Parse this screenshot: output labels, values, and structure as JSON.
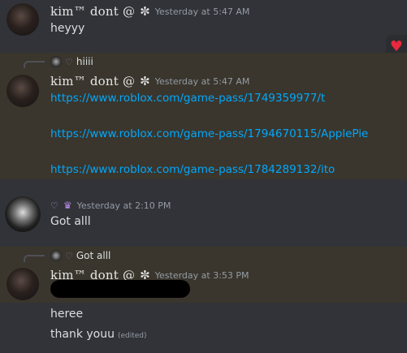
{
  "messages": {
    "m1": {
      "username": "kim™ dont @",
      "timestamp": "Yesterday at 5:47 AM",
      "text": "heyyy"
    },
    "m2": {
      "reply_text": "hiiii",
      "username": "kim™ dont @",
      "timestamp": "Yesterday at 5:47 AM",
      "links": [
        "https://www.roblox.com/game-pass/1749359977/t",
        "https://www.roblox.com/game-pass/1794670115/ApplePie",
        "https://www.roblox.com/game-pass/1784289132/ito"
      ]
    },
    "m3": {
      "timestamp": "Yesterday at 2:10 PM",
      "text": "Got alll"
    },
    "m4": {
      "reply_text": "Got alll",
      "username": "kim™ dont @",
      "timestamp": "Yesterday at 3:53 PM",
      "lines": [
        "heree",
        "thank youu"
      ],
      "edited_label": "(edited)"
    }
  },
  "glyphs": {
    "leaf": "✼",
    "heart": "♡",
    "crown": "♛",
    "reaction": "♥"
  },
  "colors": {
    "background": "#313338",
    "highlight": "#3a362d",
    "link": "#00a8fc",
    "timestamp": "#949ba4",
    "reaction_heart": "#e8283c",
    "accent_purple": "#b98ce8"
  }
}
